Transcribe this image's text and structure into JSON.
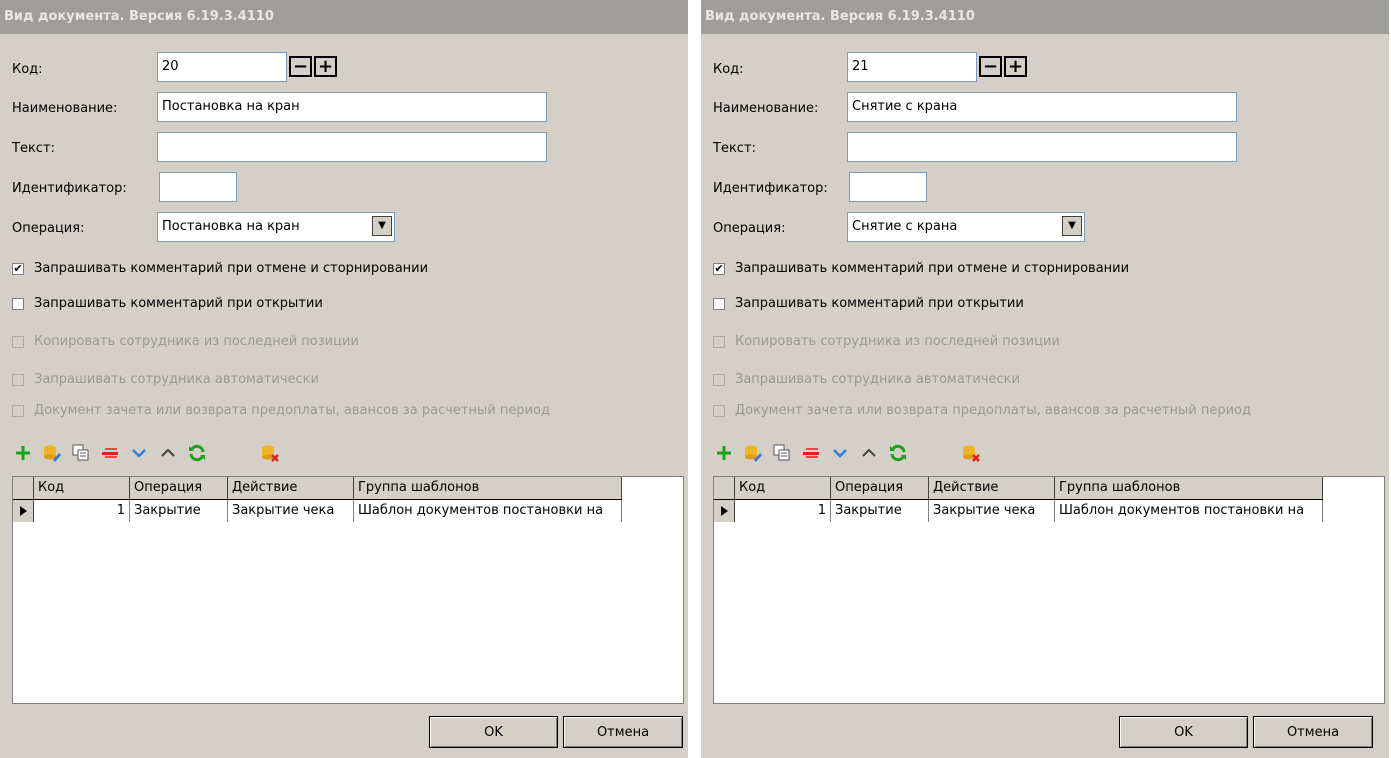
{
  "dialogs": [
    {
      "title": "Вид документа. Версия 6.19.3.4110",
      "labels": {
        "code": "Код:",
        "name": "Наименование:",
        "text": "Текст:",
        "identifier": "Идентификатор:",
        "operation": "Операция:"
      },
      "code_value": "20",
      "stepper": {
        "minus": "−",
        "plus": "+"
      },
      "name_value": "Постановка на кран",
      "text_value": "",
      "identifier_value": "",
      "operation_value": "Постановка на кран",
      "checkboxes": [
        {
          "label": "Запрашивать комментарий при отмене и сторнировании",
          "checked": true,
          "enabled": true
        },
        {
          "label": "Запрашивать комментарий при открытии",
          "checked": false,
          "enabled": true
        },
        {
          "label": "Копировать сотрудника из последней позиции",
          "checked": false,
          "enabled": false
        },
        {
          "label": "Запрашивать сотрудника автоматически",
          "checked": false,
          "enabled": false
        },
        {
          "label": "Документ зачета или возврата предоплаты, авансов за расчетный период",
          "checked": false,
          "enabled": false
        }
      ],
      "toolbar_icons": [
        "add-icon",
        "edit-icon",
        "copy-icon",
        "delete-icon",
        "move-down-icon",
        "move-up-icon",
        "refresh-icon",
        "clear-icon"
      ],
      "grid": {
        "columns": [
          "Код",
          "Операция",
          "Действие",
          "Группа шаблонов"
        ],
        "rows": [
          [
            "1",
            "Закрытие",
            "Закрытие чека",
            "Шаблон документов постановки на"
          ]
        ]
      },
      "ok_label": "OK",
      "cancel_label": "Отмена"
    },
    {
      "title": "Вид документа. Версия 6.19.3.4110",
      "labels": {
        "code": "Код:",
        "name": "Наименование:",
        "text": "Текст:",
        "identifier": "Идентификатор:",
        "operation": "Операция:"
      },
      "code_value": "21",
      "stepper": {
        "minus": "−",
        "plus": "+"
      },
      "name_value": "Снятие с крана",
      "text_value": "",
      "identifier_value": "",
      "operation_value": "Снятие с крана",
      "checkboxes": [
        {
          "label": "Запрашивать комментарий при отмене и сторнировании",
          "checked": true,
          "enabled": true
        },
        {
          "label": "Запрашивать комментарий при открытии",
          "checked": false,
          "enabled": true
        },
        {
          "label": "Копировать сотрудника из последней позиции",
          "checked": false,
          "enabled": false
        },
        {
          "label": "Запрашивать сотрудника автоматически",
          "checked": false,
          "enabled": false
        },
        {
          "label": "Документ зачета или возврата предоплаты, авансов за расчетный период",
          "checked": false,
          "enabled": false
        }
      ],
      "toolbar_icons": [
        "add-icon",
        "edit-icon",
        "copy-icon",
        "delete-icon",
        "move-down-icon",
        "move-up-icon",
        "refresh-icon",
        "clear-icon"
      ],
      "grid": {
        "columns": [
          "Код",
          "Операция",
          "Действие",
          "Группа шаблонов"
        ],
        "rows": [
          [
            "1",
            "Закрытие",
            "Закрытие чека",
            "Шаблон документов постановки на"
          ]
        ]
      },
      "ok_label": "OK",
      "cancel_label": "Отмена"
    }
  ]
}
